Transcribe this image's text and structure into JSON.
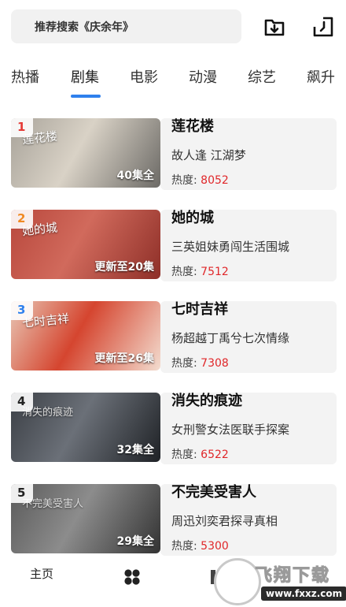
{
  "search": {
    "placeholder_text": "推荐搜索《庆余年》"
  },
  "top_icons": {
    "download": "download-icon",
    "history": "history-icon"
  },
  "tabs": [
    {
      "label": "热播",
      "active": false
    },
    {
      "label": "剧集",
      "active": true
    },
    {
      "label": "电影",
      "active": false
    },
    {
      "label": "动漫",
      "active": false
    },
    {
      "label": "综艺",
      "active": false
    },
    {
      "label": "飙升",
      "active": false
    }
  ],
  "heat_label": "热度:",
  "items": [
    {
      "rank": "1",
      "rank_color": "#e53935",
      "poster_text": "莲花楼",
      "episodes": "40集全",
      "title": "莲花楼",
      "desc": "故人逢 江湖梦",
      "heat": "8052",
      "colors": [
        "#a8a39a",
        "#d9d2c6",
        "#6c6a66"
      ]
    },
    {
      "rank": "2",
      "rank_color": "#f08a24",
      "poster_text": "她的城",
      "episodes": "更新至20集",
      "title": "她的城",
      "desc": "三英姐妹勇闯生活围城",
      "heat": "7512",
      "colors": [
        "#b8473c",
        "#d16a5c",
        "#8e2f28"
      ]
    },
    {
      "rank": "3",
      "rank_color": "#2f80ed",
      "poster_text": "七时吉祥",
      "episodes": "更新至26集",
      "title": "七时吉祥",
      "desc": "杨超越丁禹兮七次情缘",
      "heat": "7308",
      "colors": [
        "#e8c6b4",
        "#d5452f",
        "#f3dccf"
      ]
    },
    {
      "rank": "4",
      "rank_color": "#222222",
      "poster_text": "消失的痕迹",
      "episodes": "32集全",
      "title": "消失的痕迹",
      "desc": "女刑警女法医联手探案",
      "heat": "6522",
      "colors": [
        "#3b3f45",
        "#6b7078",
        "#1f2226"
      ]
    },
    {
      "rank": "5",
      "rank_color": "#222222",
      "poster_text": "不完美受害人",
      "episodes": "29集全",
      "title": "不完美受害人",
      "desc": "周迅刘奕君探寻真相",
      "heat": "5300",
      "colors": [
        "#5a5a5a",
        "#8c8c8c",
        "#333333"
      ]
    }
  ],
  "bottom_nav": {
    "home_label": "主页",
    "category_icon": "category-grid-icon"
  },
  "watermark": {
    "text": "飞翔下载",
    "url": "www.fxxz.com"
  }
}
